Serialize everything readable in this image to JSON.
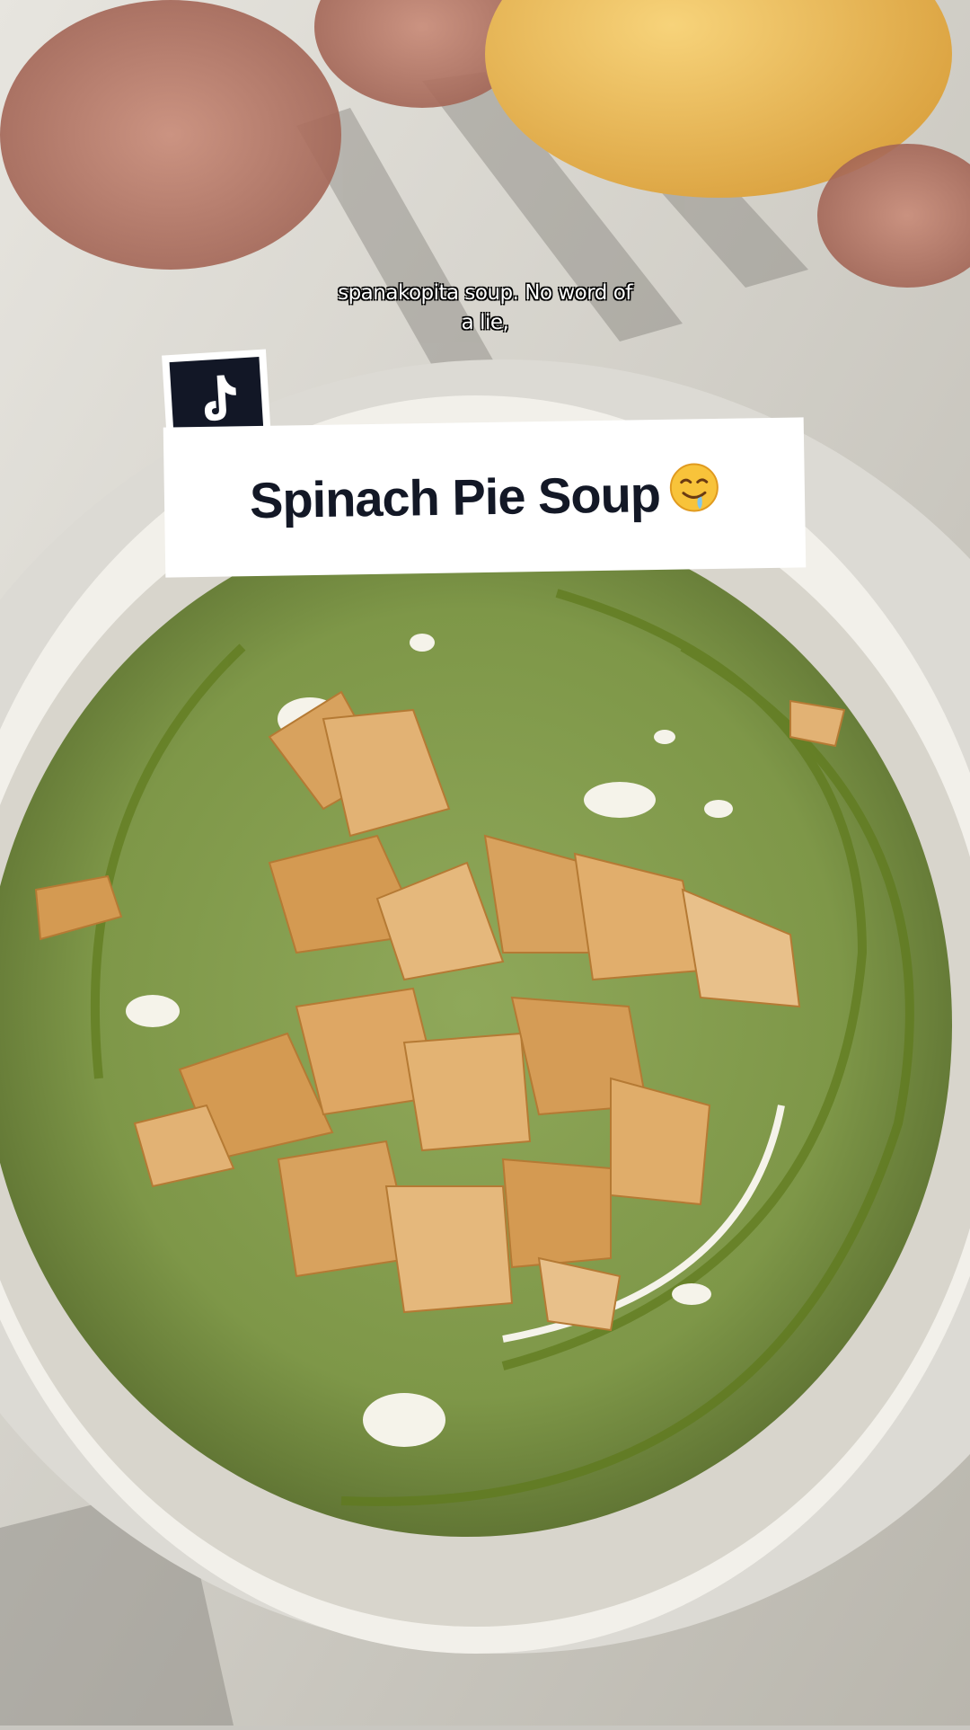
{
  "video": {
    "caption_line1": "spanakopita soup. No word of",
    "caption_line2": "a lie,",
    "title": "Spinach Pie Soup",
    "title_emoji": "drooling-face-icon",
    "brand_icon": "tiktok-note-icon"
  },
  "colors": {
    "title_text": "#131826",
    "badge_bg": "#121726",
    "soup_green": "#7f9a4c",
    "pastry": "#d8a25e"
  }
}
